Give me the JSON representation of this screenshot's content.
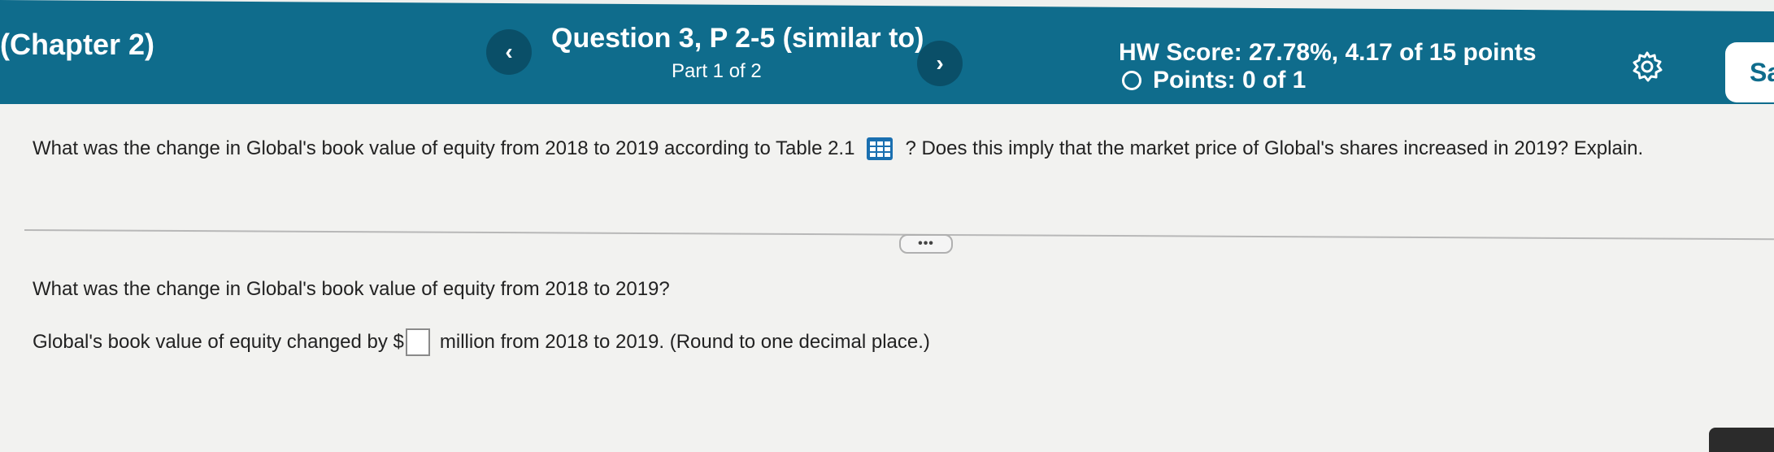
{
  "header": {
    "chapter": "(Chapter 2)",
    "prev_icon": "chevron-left-icon",
    "prev_glyph": "‹",
    "question_title": "Question 3, P 2-5 (similar to)",
    "question_part": "Part 1 of 2",
    "next_icon": "chevron-right-icon",
    "next_glyph": "›",
    "hw_score": "HW Score: 27.78%, 4.17 of 15 points",
    "points": "Points: 0 of 1",
    "settings_icon": "gear-icon",
    "save_label": "Sa"
  },
  "question": {
    "text_before": "What was the change in Global's book value of equity from 2018 to 2019 according to Table 2.1",
    "table_icon": "table-icon",
    "text_after": "? Does this imply that the market price of Global's shares increased in 2019? Explain.",
    "more_label": "•••"
  },
  "part": {
    "sub_question": "What was the change in Global's book value of equity from 2018 to 2019?",
    "answer_prefix": "Global's book value of equity changed by $",
    "answer_value": "",
    "answer_suffix": "million from 2018 to 2019.  (Round to one decimal place.)"
  },
  "colors": {
    "header_bg": "#0f6c8c",
    "nav_btn_bg": "#0a4f68",
    "page_bg": "#f2f2f0",
    "table_icon": "#1a6fb0"
  }
}
